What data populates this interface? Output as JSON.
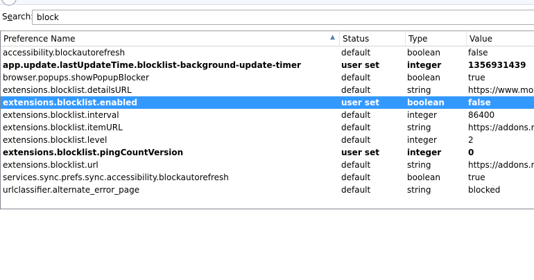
{
  "search": {
    "label_prefix": "S",
    "label_accel": "e",
    "label_suffix": "arch:",
    "value": "block"
  },
  "columns": {
    "name": "Preference Name",
    "status": "Status",
    "type": "Type",
    "value": "Value"
  },
  "rows": [
    {
      "name": "accessibility.blockautorefresh",
      "status": "default",
      "type": "boolean",
      "value": "false",
      "bold": false,
      "selected": false
    },
    {
      "name": "app.update.lastUpdateTime.blocklist-background-update-timer",
      "status": "user set",
      "type": "integer",
      "value": "1356931439",
      "bold": true,
      "selected": false
    },
    {
      "name": "browser.popups.showPopupBlocker",
      "status": "default",
      "type": "boolean",
      "value": "true",
      "bold": false,
      "selected": false
    },
    {
      "name": "extensions.blocklist.detailsURL",
      "status": "default",
      "type": "string",
      "value": "https://www.mozi",
      "bold": false,
      "selected": false
    },
    {
      "name": "extensions.blocklist.enabled",
      "status": "user set",
      "type": "boolean",
      "value": "false",
      "bold": true,
      "selected": true
    },
    {
      "name": "extensions.blocklist.interval",
      "status": "default",
      "type": "integer",
      "value": "86400",
      "bold": false,
      "selected": false
    },
    {
      "name": "extensions.blocklist.itemURL",
      "status": "default",
      "type": "string",
      "value": "https://addons.m",
      "bold": false,
      "selected": false
    },
    {
      "name": "extensions.blocklist.level",
      "status": "default",
      "type": "integer",
      "value": "2",
      "bold": false,
      "selected": false
    },
    {
      "name": "extensions.blocklist.pingCountVersion",
      "status": "user set",
      "type": "integer",
      "value": "0",
      "bold": true,
      "selected": false
    },
    {
      "name": "extensions.blocklist.url",
      "status": "default",
      "type": "string",
      "value": "https://addons.m",
      "bold": false,
      "selected": false
    },
    {
      "name": "services.sync.prefs.sync.accessibility.blockautorefresh",
      "status": "default",
      "type": "boolean",
      "value": "true",
      "bold": false,
      "selected": false
    },
    {
      "name": "urlclassifier.alternate_error_page",
      "status": "default",
      "type": "string",
      "value": "blocked",
      "bold": false,
      "selected": false
    }
  ]
}
